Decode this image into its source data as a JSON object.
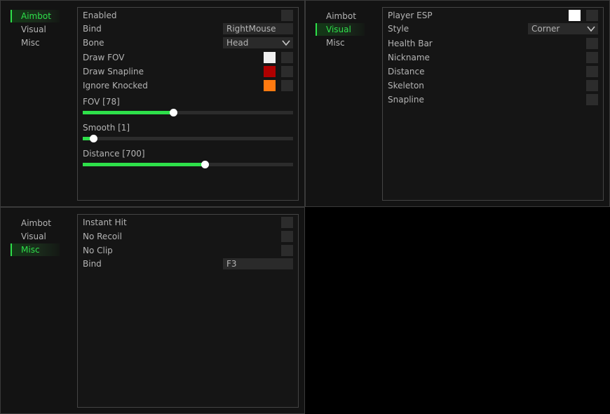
{
  "windows": {
    "aimbot": {
      "tabs": [
        {
          "label": "Aimbot",
          "active": true
        },
        {
          "label": "Visual",
          "active": false
        },
        {
          "label": "Misc",
          "active": false
        }
      ],
      "enabled": {
        "label": "Enabled",
        "checked": false
      },
      "bind": {
        "label": "Bind",
        "value": "RightMouse"
      },
      "bone": {
        "label": "Bone",
        "value": "Head"
      },
      "draw_fov": {
        "label": "Draw FOV",
        "color": "#f0f0f0",
        "checked": false
      },
      "draw_snapline": {
        "label": "Draw Snapline",
        "color": "#b00000",
        "checked": false
      },
      "ignore_knocked": {
        "label": "Ignore Knocked",
        "color": "#ff7a10",
        "checked": false
      },
      "sliders": [
        {
          "label": "FOV [78]",
          "fraction": 0.43
        },
        {
          "label": "Smooth [1]",
          "fraction": 0.05
        },
        {
          "label": "Distance [700]",
          "fraction": 0.58
        }
      ]
    },
    "visual": {
      "tabs": [
        {
          "label": "Aimbot",
          "active": false
        },
        {
          "label": "Visual",
          "active": true
        },
        {
          "label": "Misc",
          "active": false
        }
      ],
      "player_esp": {
        "label": "Player ESP",
        "color": "#ffffff",
        "checked": false
      },
      "style": {
        "label": "Style",
        "value": "Corner"
      },
      "items": [
        {
          "label": "Health Bar",
          "checked": false
        },
        {
          "label": "Nickname",
          "checked": false
        },
        {
          "label": "Distance",
          "checked": false
        },
        {
          "label": "Skeleton",
          "checked": false
        },
        {
          "label": "Snapline",
          "checked": false
        }
      ]
    },
    "misc": {
      "tabs": [
        {
          "label": "Aimbot",
          "active": false
        },
        {
          "label": "Visual",
          "active": false
        },
        {
          "label": "Misc",
          "active": true
        }
      ],
      "items": [
        {
          "label": "Instant Hit",
          "checked": false
        },
        {
          "label": "No Recoil",
          "checked": false
        },
        {
          "label": "No Clip",
          "checked": false
        }
      ],
      "bind": {
        "label": "Bind",
        "value": "F3"
      }
    }
  },
  "colors": {
    "accent": "#2ee04a",
    "checkbox": "#2c2c2c",
    "panel_border": "#444444"
  },
  "icons": {
    "dropdown": "chevron-down-icon"
  }
}
